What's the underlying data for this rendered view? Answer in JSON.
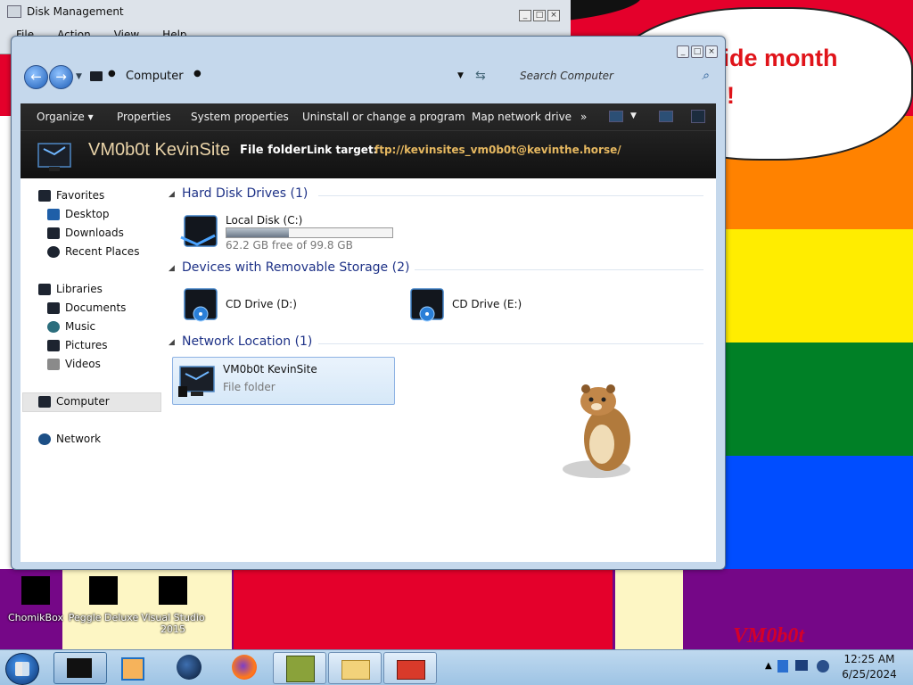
{
  "disk_mgmt": {
    "title": "Disk Management",
    "menu": [
      "File",
      "Action",
      "View",
      "Help"
    ]
  },
  "desktop": {
    "speech_lines": [
      "ride month",
      "e!"
    ],
    "watermark": "VM0b0t",
    "icons": [
      {
        "label": "ChomikBox"
      },
      {
        "label": "Peggle Deluxe"
      },
      {
        "label": "Visual Studio 2015"
      }
    ],
    "stripe_colors": [
      "#ffffff",
      "#e4002b",
      "#ff8200",
      "#ffed00",
      "#008026",
      "#004dff",
      "#750787"
    ]
  },
  "explorer": {
    "address": "Computer",
    "search_placeholder": "Search Computer",
    "toolbar": {
      "organize": "Organize",
      "properties": "Properties",
      "system_properties": "System properties",
      "uninstall": "Uninstall or change a program",
      "map_drive": "Map network drive",
      "more": "»"
    },
    "details": {
      "name": "VM0b0t KevinSite",
      "type": "File folder",
      "link_label": "Link target:",
      "link_value": "ftp://kevinsites_vm0b0t@kevinthe.horse/"
    },
    "nav": {
      "favorites": "Favorites",
      "desktop": "Desktop",
      "downloads": "Downloads",
      "recent": "Recent Places",
      "libraries": "Libraries",
      "documents": "Documents",
      "music": "Music",
      "pictures": "Pictures",
      "videos": "Videos",
      "computer": "Computer",
      "network": "Network"
    },
    "groups": {
      "hdd": "Hard Disk Drives (1)",
      "removable": "Devices with Removable Storage (2)",
      "network": "Network Location (1)"
    },
    "items": {
      "local_disk": {
        "name": "Local Disk (C:)",
        "free": "62.2 GB free of 99.8 GB",
        "used_fraction": 0.377
      },
      "cd_d": {
        "name": "CD Drive (D:)"
      },
      "cd_e": {
        "name": "CD Drive (E:)"
      },
      "netloc": {
        "name": "VM0b0t KevinSite",
        "sub": "File folder"
      }
    }
  },
  "taskbar": {
    "time": "12:25 AM",
    "date": "6/25/2024"
  }
}
